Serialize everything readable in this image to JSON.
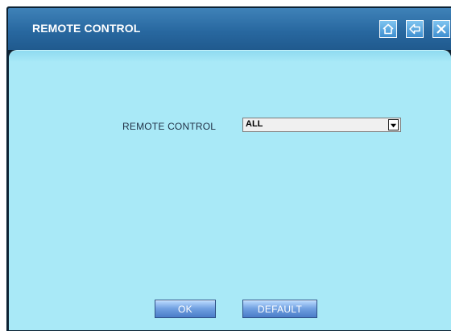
{
  "window": {
    "title": "REMOTE CONTROL",
    "title_buttons": [
      {
        "name": "home-button",
        "icon": "home-icon"
      },
      {
        "name": "back-button",
        "icon": "back-arrow-icon"
      },
      {
        "name": "close-button",
        "icon": "close-icon"
      }
    ]
  },
  "form": {
    "remote_control_label": "REMOTE CONTROL",
    "remote_control_value": "ALL"
  },
  "buttons": {
    "ok_label": "OK",
    "default_label": "DEFAULT"
  },
  "colors": {
    "titlebar": "#2868a0",
    "content_bg": "#a9e9f7",
    "button": "#6f9fe0"
  }
}
